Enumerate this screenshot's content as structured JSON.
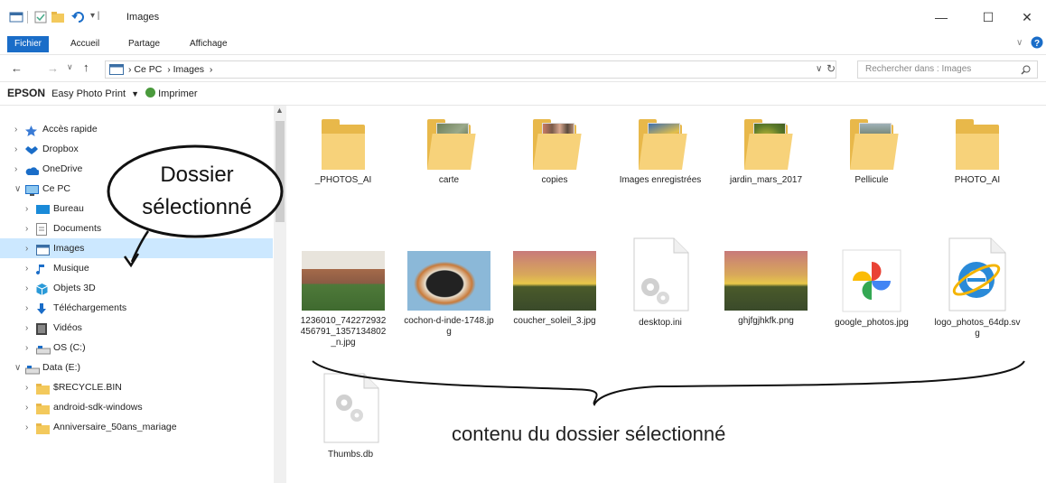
{
  "window": {
    "title": "Images",
    "controls": {
      "minimize": "—",
      "maximize": "☐",
      "close": "✕"
    }
  },
  "ribbon": {
    "tabs": [
      "Fichier",
      "Accueil",
      "Partage",
      "Affichage"
    ]
  },
  "address": {
    "breadcrumb": [
      "Ce PC",
      "Images"
    ],
    "search_placeholder": "Rechercher dans : Images"
  },
  "epson": {
    "brand": "EPSON",
    "app": "Easy Photo Print",
    "print": "Imprimer"
  },
  "sidebar": {
    "items": [
      {
        "label": "Accès rapide",
        "indent": 0,
        "expanded": false,
        "icon": "star-icon"
      },
      {
        "label": "Dropbox",
        "indent": 0,
        "expanded": false,
        "icon": "dropbox-icon"
      },
      {
        "label": "OneDrive",
        "indent": 0,
        "expanded": false,
        "icon": "cloud-icon"
      },
      {
        "label": "Ce PC",
        "indent": 0,
        "expanded": true,
        "icon": "pc-icon"
      },
      {
        "label": "Bureau",
        "indent": 1,
        "expanded": false,
        "icon": "desktop-icon"
      },
      {
        "label": "Documents",
        "indent": 1,
        "expanded": false,
        "icon": "documents-icon"
      },
      {
        "label": "Images",
        "indent": 1,
        "expanded": false,
        "icon": "images-icon",
        "selected": true
      },
      {
        "label": "Musique",
        "indent": 1,
        "expanded": false,
        "icon": "music-icon"
      },
      {
        "label": "Objets 3D",
        "indent": 1,
        "expanded": false,
        "icon": "cube-icon"
      },
      {
        "label": "Téléchargements",
        "indent": 1,
        "expanded": false,
        "icon": "download-icon"
      },
      {
        "label": "Vidéos",
        "indent": 1,
        "expanded": false,
        "icon": "video-icon"
      },
      {
        "label": "OS (C:)",
        "indent": 1,
        "expanded": false,
        "icon": "drive-icon"
      },
      {
        "label": "Data (E:)",
        "indent": 0,
        "expanded": true,
        "icon": "drive-icon"
      },
      {
        "label": "$RECYCLE.BIN",
        "indent": 1,
        "expanded": false,
        "icon": "folder-icon"
      },
      {
        "label": "android-sdk-windows",
        "indent": 1,
        "expanded": false,
        "icon": "folder-icon"
      },
      {
        "label": "Anniversaire_50ans_mariage",
        "indent": 1,
        "expanded": false,
        "icon": "folder-icon"
      }
    ]
  },
  "folders": [
    {
      "name": "_PHOTOS_AI",
      "icon": "folder-icon"
    },
    {
      "name": "carte",
      "icon": "folder-icon"
    },
    {
      "name": "copies",
      "icon": "folder-icon"
    },
    {
      "name": "Images enregistrées",
      "icon": "folder-icon"
    },
    {
      "name": "jardin_mars_2017",
      "icon": "folder-icon"
    },
    {
      "name": "Pellicule",
      "icon": "folder-icon"
    },
    {
      "name": "PHOTO_AI",
      "icon": "folder-icon"
    }
  ],
  "files": [
    {
      "name": "1236010_742272932456791_1357134802_n.jpg",
      "icon": "photo-house-icon"
    },
    {
      "name": "cochon-d-inde-1748.jpg",
      "icon": "photo-guinea-pig-icon"
    },
    {
      "name": "coucher_soleil_3.jpg",
      "icon": "photo-sunset-icon"
    },
    {
      "name": "desktop.ini",
      "icon": "settings-file-icon"
    },
    {
      "name": "ghjfgjhkfk.png",
      "icon": "photo-sunset-icon"
    },
    {
      "name": "google_photos.jpg",
      "icon": "google-photos-icon"
    },
    {
      "name": "logo_photos_64dp.svg",
      "icon": "internet-explorer-icon"
    },
    {
      "name": "Thumbs.db",
      "icon": "settings-file-icon"
    }
  ],
  "annotations": {
    "bubble": "Dossier sélectionné",
    "brace_caption": "contenu du dossier sélectionné"
  },
  "colors": {
    "accent": "#1a6dc8",
    "selection": "#cce8ff",
    "folder": "#e8b84a"
  }
}
